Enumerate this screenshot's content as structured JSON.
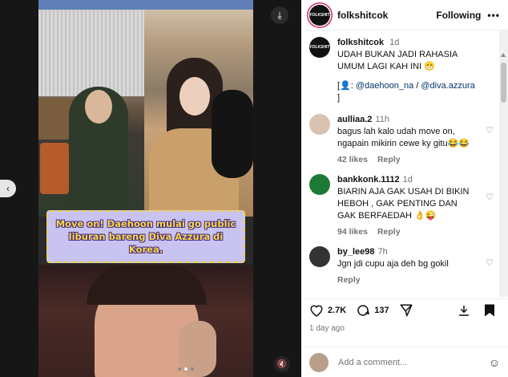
{
  "post": {
    "username": "folkshitcok",
    "avatar_label": "FOLKSHIT",
    "follow_label": "Following",
    "more_label": "•••",
    "media_caption": "Move on! Daehoon mulai go public liburan bareng Diva Azzura di Korea.",
    "caption": {
      "username": "folkshitcok",
      "time": "1d",
      "text": "UDAH BUKAN JADI RAHASIA UMUM LAGI KAH INI 😁",
      "prefix": "[👤: ",
      "mention1": "@daehoon_na",
      "sep": " / ",
      "mention2": "@diva.azzura",
      "suffix": " ]"
    },
    "likes": "2.7K",
    "comments_count": "137",
    "date": "1 day ago",
    "add_comment_placeholder": "Add a comment..."
  },
  "comments": [
    {
      "user": "aulliaa.2",
      "time": "11h",
      "text": "bagus lah kalo udah move on, ngapain mikirin cewe ky gitu😂😂",
      "likes": "42 likes",
      "reply": "Reply",
      "avatar_color": "#d9c2b0"
    },
    {
      "user": "bankkonk.1112",
      "time": "1d",
      "text": "BIARIN AJA GAK USAH DI BIKIN HEBOH , GAK PENTING DAN GAK BERFAEDAH 👌😜",
      "likes": "94 likes",
      "reply": "Reply",
      "avatar_color": "#1c7a36"
    },
    {
      "user": "by_lee98",
      "time": "7h",
      "text": "Jgn jdi cupu aja deh bg gokil",
      "likes": "",
      "reply": "Reply",
      "avatar_color": "#333333"
    }
  ],
  "icons": {
    "download": "download-icon",
    "prev": "chevron-left-icon",
    "mute": "mute-icon",
    "heart": "heart-icon",
    "comment": "comment-icon",
    "share": "share-icon",
    "save": "bookmark-icon"
  }
}
